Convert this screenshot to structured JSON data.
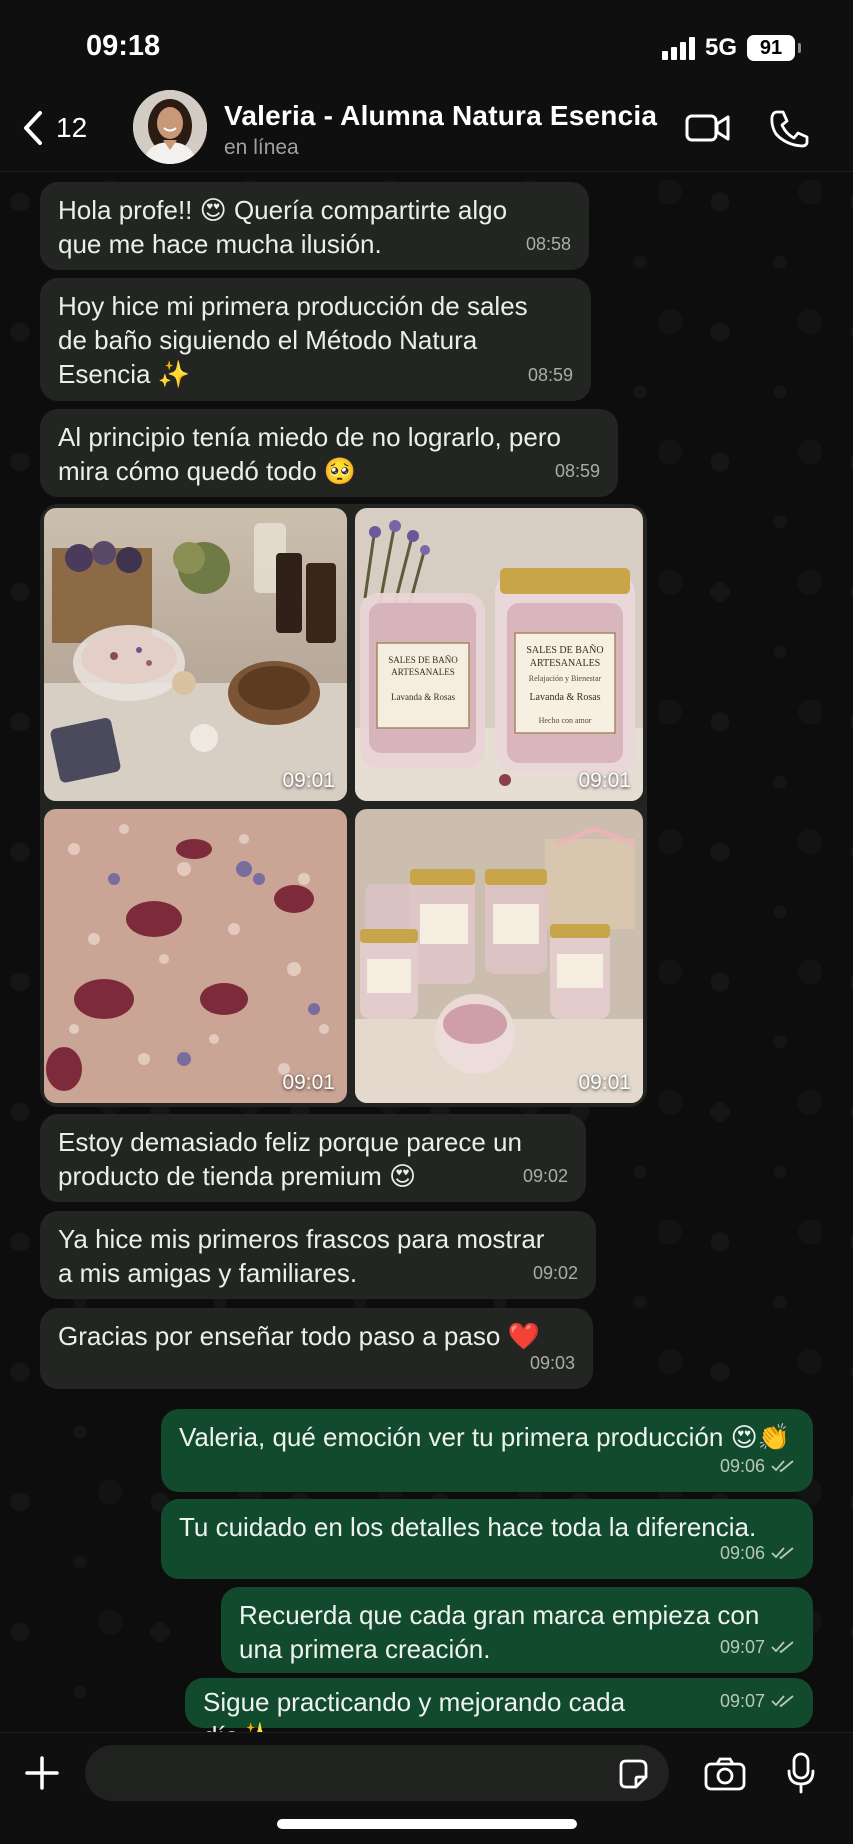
{
  "status_bar": {
    "time": "09:18",
    "network": "5G",
    "battery": "91"
  },
  "header": {
    "back_count": "12",
    "contact_name": "Valeria - Alumna Natura Esencia",
    "contact_status": "en línea"
  },
  "messages_in": [
    {
      "text": "Hola profe!! 😍 Quería compartirte algo\nque me hace mucha ilusión.",
      "time": "08:58"
    },
    {
      "text": "Hoy hice mi primera producción de sales\nde baño siguiendo el Método Natura\nEsencia ✨",
      "time": "08:59"
    },
    {
      "text": "Al principio tenía miedo de no lograrlo, pero\nmira cómo quedó todo 🥺",
      "time": "08:59"
    }
  ],
  "photos": [
    {
      "time": "09:01"
    },
    {
      "time": "09:01",
      "label_title": "SALES DE BAÑO\nARTESANALES",
      "label_sub": "Relajación y Bienestar",
      "label_scent": "Lavanda & Rosas",
      "label_foot": "Hecho con amor"
    },
    {
      "time": "09:01"
    },
    {
      "time": "09:01"
    }
  ],
  "messages_in_2": [
    {
      "text": "Estoy demasiado feliz porque parece un\nproducto de tienda premium 😍",
      "time": "09:02"
    },
    {
      "text": "Ya hice mis primeros frascos para mostrar\na mis amigas y familiares.",
      "time": "09:02"
    },
    {
      "text": "Gracias por enseñar todo paso a paso ❤️",
      "time": "09:03"
    }
  ],
  "messages_out": [
    {
      "text": "Valeria, qué emoción ver tu primera producción 😍👏",
      "time": "09:06"
    },
    {
      "text": "Tu cuidado en los detalles hace toda la diferencia.",
      "time": "09:06"
    },
    {
      "text": "Recuerda que cada gran marca empieza con\nuna primera creación.",
      "time": "09:07"
    },
    {
      "text": "Sigue practicando y mejorando cada día✨",
      "time": "09:07"
    }
  ],
  "colors": {
    "incoming_bubble": "#232523",
    "outgoing_bubble": "#124a2d",
    "background": "#0c0d0c"
  },
  "icons": [
    "back-chevron-icon",
    "video-call-icon",
    "phone-icon",
    "plus-icon",
    "sticker-icon",
    "camera-icon",
    "microphone-icon",
    "double-check-icon"
  ]
}
